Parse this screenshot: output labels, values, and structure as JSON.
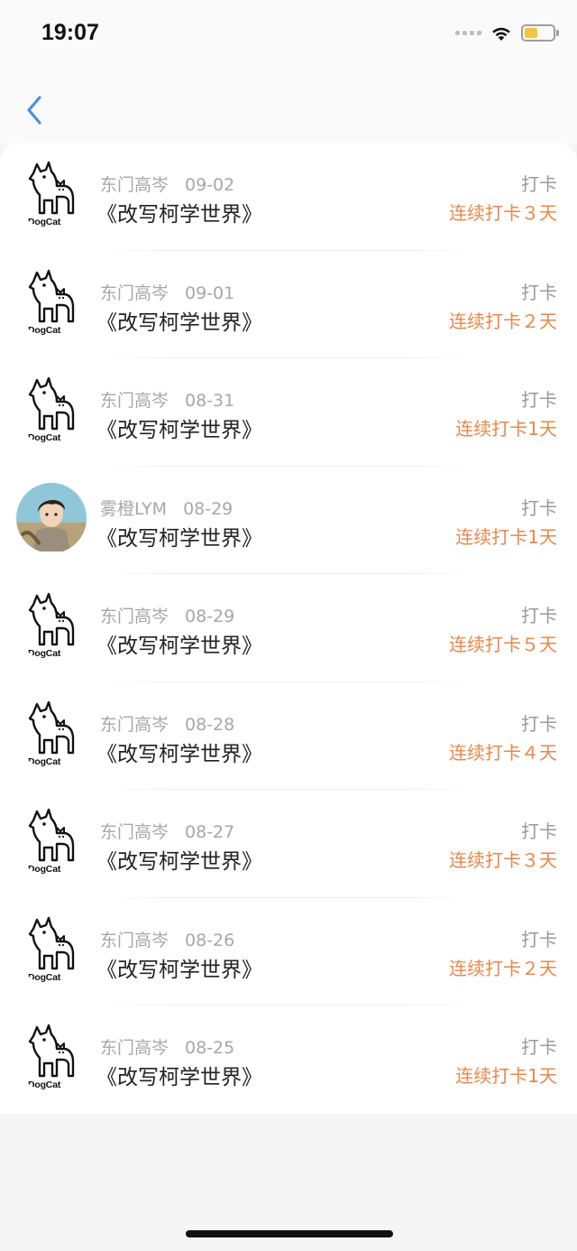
{
  "status_bar": {
    "time": "19:07"
  },
  "theme": {
    "accent": "#e8874a",
    "back_color": "#4a90e2"
  },
  "records": [
    {
      "avatar": "dogcat-logo-icon",
      "logo_text": "DogCat",
      "author": "东门高岑",
      "date": "09-02",
      "title": "《改写柯学世界》",
      "action": "打卡",
      "streak": "连续打卡３天"
    },
    {
      "avatar": "dogcat-logo-icon",
      "logo_text": "DogCat",
      "author": "东门高岑",
      "date": "09-01",
      "title": "《改写柯学世界》",
      "action": "打卡",
      "streak": "连续打卡２天"
    },
    {
      "avatar": "dogcat-logo-icon",
      "logo_text": "DogCat",
      "author": "东门高岑",
      "date": "08-31",
      "title": "《改写柯学世界》",
      "action": "打卡",
      "streak": "连续打卡1天"
    },
    {
      "avatar": "user-photo-avatar",
      "logo_text": "",
      "author": "雾橙LYM",
      "date": "08-29",
      "title": "《改写柯学世界》",
      "action": "打卡",
      "streak": "连续打卡1天"
    },
    {
      "avatar": "dogcat-logo-icon",
      "logo_text": "DogCat",
      "author": "东门高岑",
      "date": "08-29",
      "title": "《改写柯学世界》",
      "action": "打卡",
      "streak": "连续打卡５天"
    },
    {
      "avatar": "dogcat-logo-icon",
      "logo_text": "DogCat",
      "author": "东门高岑",
      "date": "08-28",
      "title": "《改写柯学世界》",
      "action": "打卡",
      "streak": "连续打卡４天"
    },
    {
      "avatar": "dogcat-logo-icon",
      "logo_text": "DogCat",
      "author": "东门高岑",
      "date": "08-27",
      "title": "《改写柯学世界》",
      "action": "打卡",
      "streak": "连续打卡３天"
    },
    {
      "avatar": "dogcat-logo-icon",
      "logo_text": "DogCat",
      "author": "东门高岑",
      "date": "08-26",
      "title": "《改写柯学世界》",
      "action": "打卡",
      "streak": "连续打卡２天"
    },
    {
      "avatar": "dogcat-logo-icon",
      "logo_text": "DogCat",
      "author": "东门高岑",
      "date": "08-25",
      "title": "《改写柯学世界》",
      "action": "打卡",
      "streak": "连续打卡1天"
    }
  ]
}
